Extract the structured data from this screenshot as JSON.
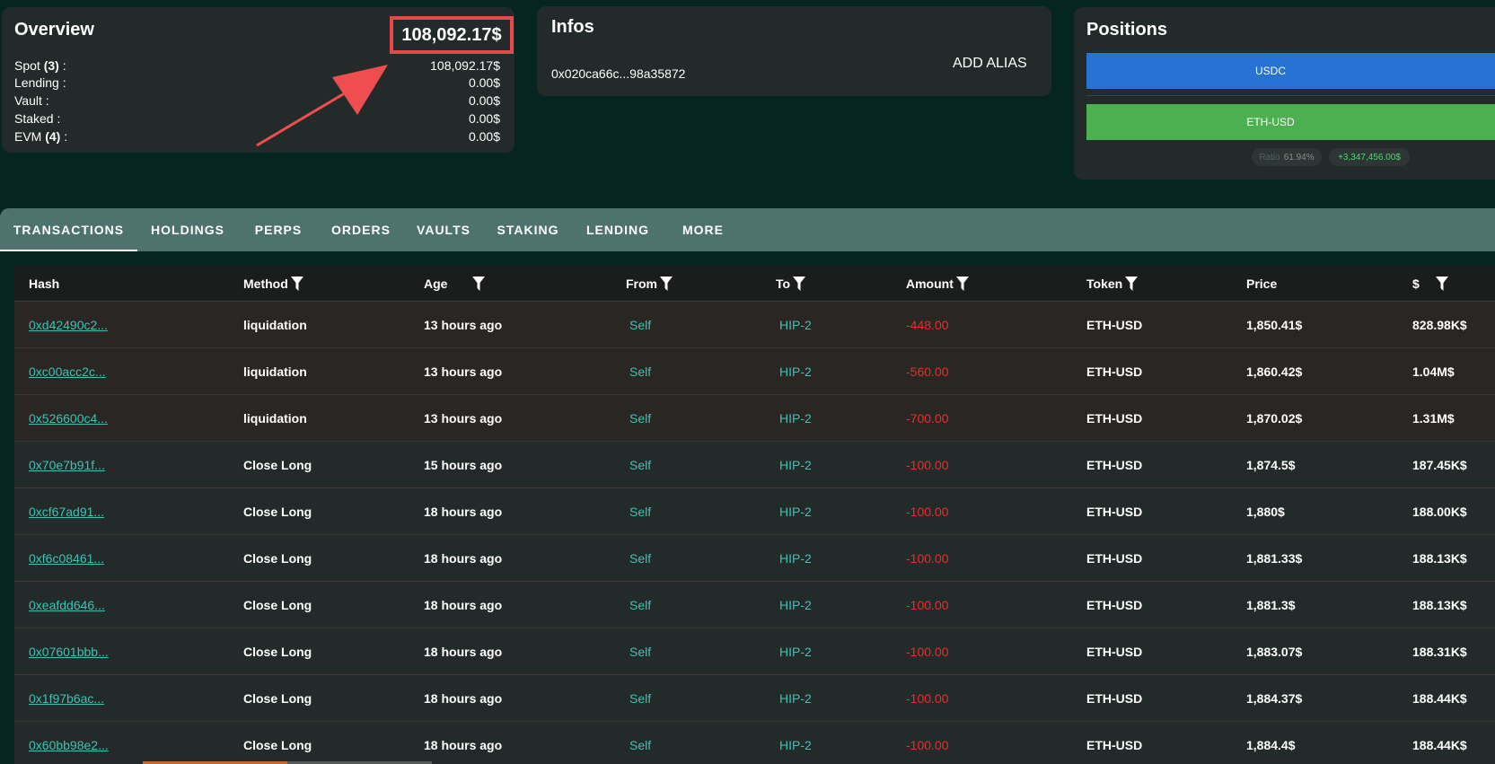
{
  "overview": {
    "title": "Overview",
    "total": "108,092.17$",
    "rows": [
      {
        "label": "Spot ",
        "count": "(3)",
        "suffix": " :",
        "value": "108,092.17$"
      },
      {
        "label": "Lending :",
        "count": "",
        "suffix": "",
        "value": "0.00$"
      },
      {
        "label": "Vault :",
        "count": "",
        "suffix": "",
        "value": "0.00$"
      },
      {
        "label": "Staked :",
        "count": "",
        "suffix": "",
        "value": "0.00$"
      },
      {
        "label": "EVM ",
        "count": "(4)",
        "suffix": " :",
        "value": "0.00$"
      }
    ]
  },
  "infos": {
    "title": "Infos",
    "address": "0x020ca66c...98a35872",
    "alias_button": "ADD ALIAS"
  },
  "positions": {
    "title": "Positions",
    "bars": [
      {
        "label": "USDC",
        "color": "#2872d4"
      },
      {
        "label": "ETH-USD",
        "color": "#4caf50"
      }
    ],
    "ratio_label": "Ratio",
    "ratio_value": "61.94%",
    "pnl": "+3,347,456.00$"
  },
  "tabs": [
    "TRANSACTIONS",
    "HOLDINGS",
    "PERPS",
    "ORDERS",
    "VAULTS",
    "STAKING",
    "LENDING",
    "MORE"
  ],
  "active_tab": "TRANSACTIONS",
  "table": {
    "columns": [
      "Hash",
      "Method",
      "Age",
      "From",
      "To",
      "Amount",
      "Token",
      "Price",
      "$"
    ],
    "rows": [
      {
        "hash": "0xd42490c2...",
        "method": "liquidation",
        "age": "13 hours ago",
        "from": "Self",
        "to": "HIP-2",
        "amount": "-448.00",
        "token": "ETH-USD",
        "price": "1,850.41$",
        "usd": "828.98K$"
      },
      {
        "hash": "0xc00acc2c...",
        "method": "liquidation",
        "age": "13 hours ago",
        "from": "Self",
        "to": "HIP-2",
        "amount": "-560.00",
        "token": "ETH-USD",
        "price": "1,860.42$",
        "usd": "1.04M$"
      },
      {
        "hash": "0x526600c4...",
        "method": "liquidation",
        "age": "13 hours ago",
        "from": "Self",
        "to": "HIP-2",
        "amount": "-700.00",
        "token": "ETH-USD",
        "price": "1,870.02$",
        "usd": "1.31M$"
      },
      {
        "hash": "0x70e7b91f...",
        "method": "Close Long",
        "age": "15 hours ago",
        "from": "Self",
        "to": "HIP-2",
        "amount": "-100.00",
        "token": "ETH-USD",
        "price": "1,874.5$",
        "usd": "187.45K$"
      },
      {
        "hash": "0xcf67ad91...",
        "method": "Close Long",
        "age": "18 hours ago",
        "from": "Self",
        "to": "HIP-2",
        "amount": "-100.00",
        "token": "ETH-USD",
        "price": "1,880$",
        "usd": "188.00K$"
      },
      {
        "hash": "0xf6c08461...",
        "method": "Close Long",
        "age": "18 hours ago",
        "from": "Self",
        "to": "HIP-2",
        "amount": "-100.00",
        "token": "ETH-USD",
        "price": "1,881.33$",
        "usd": "188.13K$"
      },
      {
        "hash": "0xeafdd646...",
        "method": "Close Long",
        "age": "18 hours ago",
        "from": "Self",
        "to": "HIP-2",
        "amount": "-100.00",
        "token": "ETH-USD",
        "price": "1,881.3$",
        "usd": "188.13K$"
      },
      {
        "hash": "0x07601bbb...",
        "method": "Close Long",
        "age": "18 hours ago",
        "from": "Self",
        "to": "HIP-2",
        "amount": "-100.00",
        "token": "ETH-USD",
        "price": "1,883.07$",
        "usd": "188.31K$"
      },
      {
        "hash": "0x1f97b6ac...",
        "method": "Close Long",
        "age": "18 hours ago",
        "from": "Self",
        "to": "HIP-2",
        "amount": "-100.00",
        "token": "ETH-USD",
        "price": "1,884.37$",
        "usd": "188.44K$"
      },
      {
        "hash": "0x60bb98e2...",
        "method": "Close Long",
        "age": "18 hours ago",
        "from": "Self",
        "to": "HIP-2",
        "amount": "-100.00",
        "token": "ETH-USD",
        "price": "1,884.4$",
        "usd": "188.44K$"
      }
    ]
  }
}
